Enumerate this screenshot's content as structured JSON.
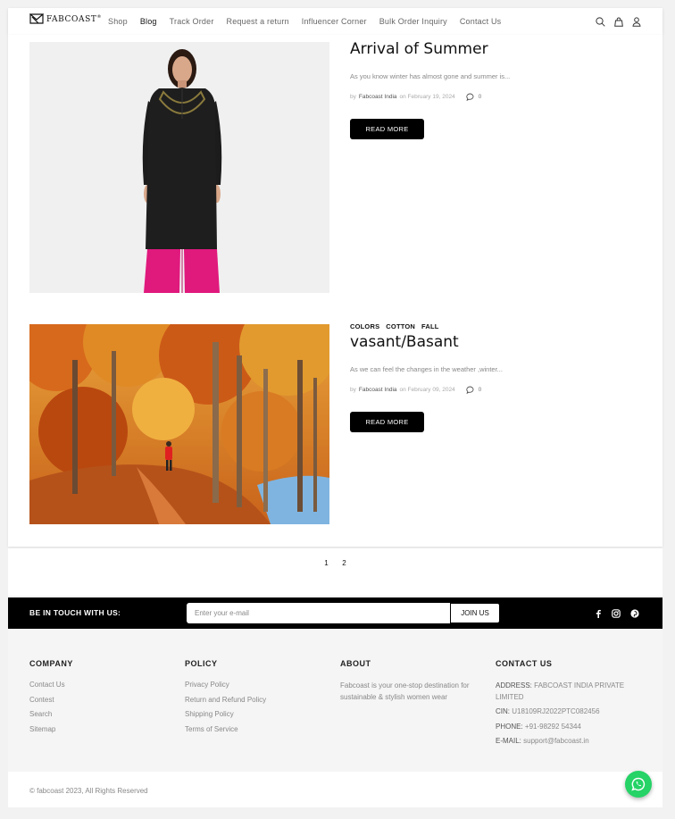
{
  "header": {
    "logo_text": "FABCOAST",
    "logo_reg": "®",
    "nav": [
      {
        "label": "Shop"
      },
      {
        "label": "Blog"
      },
      {
        "label": "Track Order"
      },
      {
        "label": "Request a return"
      },
      {
        "label": "Influencer Corner"
      },
      {
        "label": "Bulk Order Inquiry"
      },
      {
        "label": "Contact Us"
      }
    ],
    "active_nav": "Blog",
    "icons": [
      "search-icon",
      "shopping-bag-icon",
      "user-icon"
    ]
  },
  "posts": [
    {
      "tags": [],
      "title": "Arrival of Summer",
      "excerpt": "As you know winter has almost gone and summer is...",
      "by": "by",
      "author": "Fabcoast India",
      "date": "on February 19, 2024",
      "comments": "0",
      "read_more": "READ MORE"
    },
    {
      "tags": [
        "COLORS",
        "COTTON",
        "FALL"
      ],
      "title": "vasant/Basant",
      "excerpt": "As we can feel the changes in the weather ,winter...",
      "by": "by",
      "author": "Fabcoast India",
      "date": "on February 09, 2024",
      "comments": "0",
      "read_more": "READ MORE"
    }
  ],
  "pagination": {
    "pages": [
      "1",
      "2"
    ]
  },
  "newsletter": {
    "label": "BE IN TOUCH WITH US:",
    "placeholder": "Enter your e-mail",
    "button": "JOIN US",
    "social_icons": [
      "facebook-icon",
      "instagram-icon",
      "pinterest-icon"
    ]
  },
  "footer": {
    "company": {
      "title": "COMPANY",
      "links": [
        "Contact Us",
        "Contest",
        "Search",
        "Sitemap"
      ]
    },
    "policy": {
      "title": "POLICY",
      "links": [
        "Privacy Policy",
        "Return and Refund Policy",
        "Shipping Policy",
        "Terms of Service"
      ]
    },
    "about": {
      "title": "ABOUT",
      "text": "Fabcoast is your one-stop destination for sustainable & stylish women wear"
    },
    "contact": {
      "title": "CONTACT US",
      "address_label": "ADDRESS:",
      "address": "FABCOAST INDIA PRIVATE LIMITED",
      "cin_label": "CIN:",
      "cin": "U18109RJ2022PTC082456",
      "phone_label": "PHONE:",
      "phone": "+91-98292 54344",
      "email_label": "E-MAIL:",
      "email": "support@fabcoast.in"
    }
  },
  "copyright": "© fabcoast 2023, All Rights Reserved",
  "colors": {
    "accent": "#000000",
    "whatsapp": "#25d366",
    "kurta_pants": "#e0197d"
  }
}
